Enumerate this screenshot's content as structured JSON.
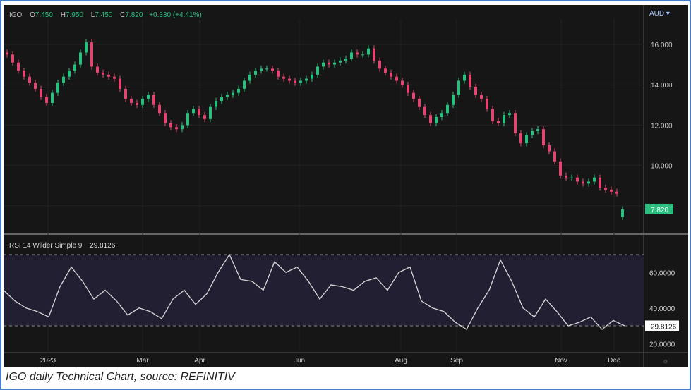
{
  "header": {
    "symbol": "IGO",
    "o_label": "O",
    "o": "7.450",
    "h_label": "H",
    "h": "7.950",
    "l_label": "L",
    "l": "7.450",
    "c_label": "C",
    "c": "7.820",
    "change": "+0.330 (+4.41%)"
  },
  "currency": "AUD",
  "rsi_legend": {
    "label": "RSI 14 Wilder Simple 9",
    "value": "29.8126"
  },
  "caption": "IGO daily Technical Chart, source: REFINITIV",
  "colors": {
    "up": "#2bbf7f",
    "down": "#e2456f",
    "rsi": "#d8d8d8",
    "bg": "#161616"
  },
  "chart_data": [
    {
      "type": "candlestick",
      "title": "IGO daily",
      "ylabel": "AUD",
      "ylim": [
        7,
        17
      ],
      "yticks": [
        "16.000",
        "14.000",
        "12.000",
        "10.000"
      ],
      "last_price": "7.820",
      "last_open": 7.45,
      "closes": [
        15.5,
        15.1,
        14.7,
        14.4,
        14.1,
        13.8,
        13.4,
        13.1,
        13.6,
        14.1,
        14.4,
        14.7,
        15.0,
        15.6,
        16.1,
        14.9,
        14.6,
        14.5,
        14.4,
        14.3,
        13.8,
        13.3,
        13.1,
        13.0,
        13.3,
        13.5,
        13.0,
        12.6,
        12.1,
        11.9,
        11.8,
        12.0,
        12.6,
        12.8,
        12.5,
        12.3,
        12.9,
        13.2,
        13.4,
        13.5,
        13.6,
        13.8,
        14.2,
        14.5,
        14.7,
        14.8,
        14.8,
        14.7,
        14.4,
        14.3,
        14.2,
        14.1,
        14.2,
        14.3,
        14.5,
        14.9,
        15.1,
        15.0,
        15.1,
        15.2,
        15.3,
        15.6,
        15.5,
        15.5,
        15.8,
        15.2,
        14.8,
        14.6,
        14.4,
        14.2,
        14.0,
        13.6,
        13.3,
        12.9,
        12.5,
        12.1,
        12.4,
        12.6,
        13.0,
        13.5,
        14.2,
        14.5,
        13.9,
        13.5,
        13.3,
        12.8,
        12.2,
        12.1,
        12.5,
        12.6,
        11.6,
        11.1,
        11.5,
        11.7,
        11.8,
        11.0,
        10.7,
        10.2,
        9.5,
        9.4,
        9.4,
        9.2,
        9.1,
        9.2,
        9.4,
        8.9,
        8.8,
        8.7,
        8.6,
        7.82
      ]
    },
    {
      "type": "line",
      "title": "RSI 14 Wilder Simple 9",
      "ylim": [
        15,
        75
      ],
      "bands": [
        30,
        70
      ],
      "yticks": [
        "60.0000",
        "40.0000",
        "20.0000"
      ],
      "last_value": "29.8126",
      "values": [
        50,
        44,
        40,
        38,
        35,
        52,
        63,
        55,
        45,
        50,
        44,
        36,
        40,
        38,
        34,
        45,
        50,
        42,
        48,
        60,
        70,
        56,
        55,
        50,
        66,
        60,
        63,
        55,
        45,
        53,
        52,
        50,
        55,
        57,
        50,
        60,
        63,
        44,
        40,
        38,
        32,
        28,
        40,
        50,
        67,
        55,
        40,
        35,
        45,
        38,
        30,
        32,
        35,
        28,
        33,
        30
      ]
    }
  ],
  "x_axis": {
    "labels": [
      "2023",
      "Mar",
      "Apr",
      "Jun",
      "Aug",
      "Sep",
      "Nov",
      "Dec"
    ]
  }
}
